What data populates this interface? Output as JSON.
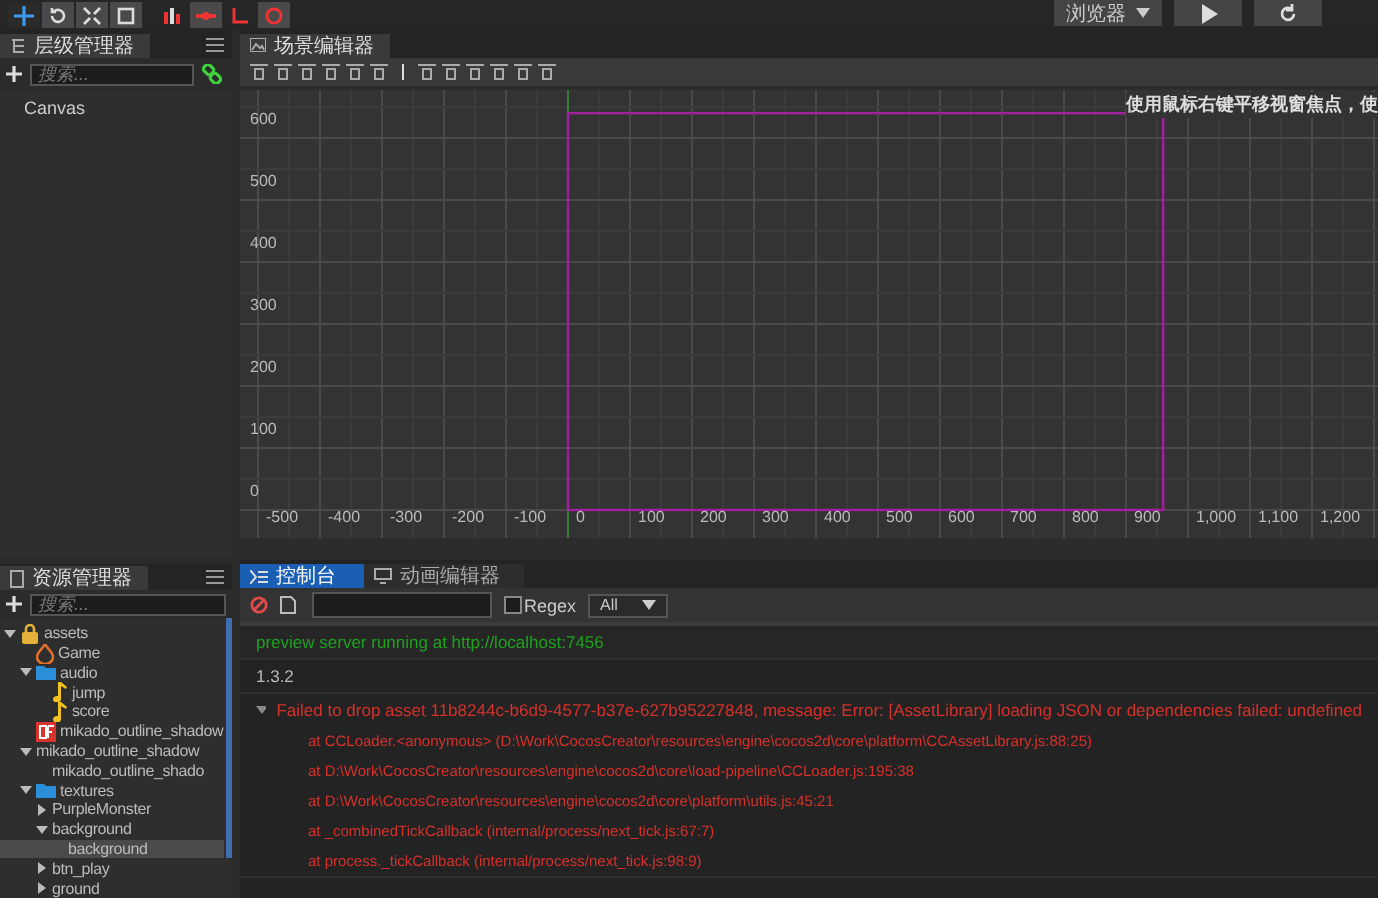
{
  "toolbar": {
    "transform_tools": [
      {
        "selected": true
      },
      {
        "selected": false
      },
      {
        "selected": false
      },
      {
        "selected": false
      }
    ],
    "preview_target": "浏览器"
  },
  "hierarchy": {
    "tab": "层级管理器",
    "search": {
      "placeholder": "搜索..."
    },
    "nodes": [
      {
        "label": "Canvas"
      }
    ]
  },
  "scene": {
    "tab": "场景编辑器",
    "hint": "使用鼠标右键平移视窗焦点，使",
    "x_ruler": [
      "-500",
      "-400",
      "-300",
      "-200",
      "-100",
      "0",
      "100",
      "200",
      "300",
      "400",
      "500",
      "600",
      "700",
      "800",
      "900",
      "1,000",
      "1,100",
      "1,200"
    ],
    "y_ruler": [
      "600",
      "500",
      "400",
      "300",
      "200",
      "100",
      "0"
    ]
  },
  "assets": {
    "tab": "资源管理器",
    "search": {
      "placeholder": "搜索..."
    },
    "tree": [
      {
        "label": "assets",
        "kind": "database",
        "expanded": true,
        "selected": false,
        "children": [
          {
            "label": "Game",
            "kind": "scene",
            "selected": false
          },
          {
            "label": "audio",
            "kind": "folder",
            "expanded": true,
            "selected": false,
            "children": [
              {
                "label": "jump",
                "kind": "audio",
                "selected": false
              },
              {
                "label": "score",
                "kind": "audio",
                "selected": false
              }
            ]
          },
          {
            "label": "mikado_outline_shadow",
            "kind": "font",
            "selected": false
          },
          {
            "label": "mikado_outline_shadow",
            "expanded": true,
            "selected": false,
            "children": [
              {
                "label": "mikado_outline_shado",
                "selected": false
              }
            ]
          },
          {
            "label": "textures",
            "kind": "folder",
            "expanded": true,
            "selected": false,
            "children": [
              {
                "label": "PurpleMonster",
                "expanded": false,
                "selected": false
              },
              {
                "label": "background",
                "expanded": true,
                "selected": false,
                "children": [
                  {
                    "label": "background",
                    "selected": true
                  }
                ]
              },
              {
                "label": "btn_play",
                "expanded": false,
                "selected": false
              },
              {
                "label": "ground",
                "expanded": false,
                "selected": false
              }
            ]
          }
        ]
      }
    ]
  },
  "bottom_tabs": [
    {
      "label": "控制台",
      "selected": true
    },
    {
      "label": "动画编辑器",
      "selected": false
    }
  ],
  "console": {
    "regex": {
      "label": "Regex",
      "checked": false
    },
    "level": "All",
    "logs": [
      {
        "kind": "info",
        "text": "preview server running at http://localhost:7456"
      },
      {
        "kind": "log",
        "text": "1.3.2"
      },
      {
        "kind": "error",
        "expanded": true,
        "text": "Failed to drop asset 11b8244c-b6d9-4577-b37e-627b95227848, message: Error: [AssetLibrary] loading JSON or dependencies failed: undefined",
        "stack": [
          "at CCLoader.<anonymous> (D:\\Work\\CocosCreator\\resources\\engine\\cocos2d\\core\\platform\\CCAssetLibrary.js:88:25)",
          "at D:\\Work\\CocosCreator\\resources\\engine\\cocos2d\\core\\load-pipeline\\CCLoader.js:195:38",
          "at D:\\Work\\CocosCreator\\resources\\engine\\cocos2d\\core\\platform\\utils.js:45:21",
          "at _combinedTickCallback (internal/process/next_tick.js:67:7)",
          "at process._tickCallback (internal/process/next_tick.js:98:9)"
        ]
      }
    ]
  }
}
